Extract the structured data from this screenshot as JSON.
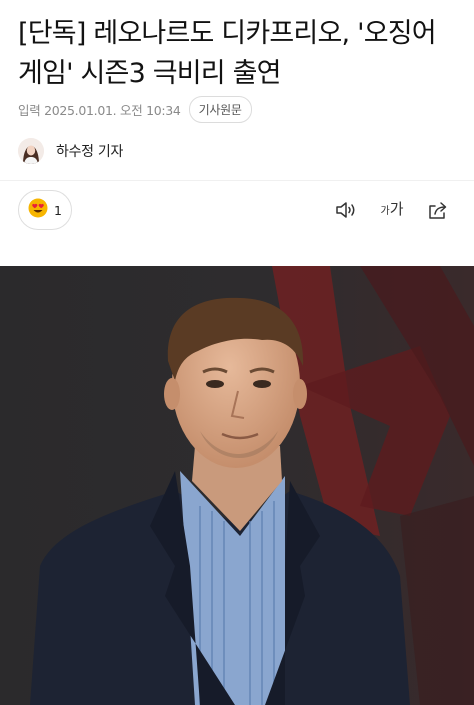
{
  "article": {
    "headline": "[단독] 레오나르도 디카프리오, '오징어게임' 시즌3 극비리 출연",
    "date": "입력 2025.01.01. 오전 10:34",
    "origin_label": "기사원문",
    "reporter": "하수정 기자"
  },
  "reaction": {
    "icon": "smiling-heart-eyes-emoji",
    "count": "1"
  },
  "toolbar": {
    "font_size_small": "가",
    "font_size_large": "가",
    "icons": [
      "speaker-icon",
      "font-size-icon",
      "share-icon"
    ]
  },
  "colors": {
    "emoji_yellow": "#f7b500",
    "heart_red": "#e8203a",
    "photo_backdrop": "#2c2b2c",
    "photo_red_accent": "#6e2122"
  }
}
